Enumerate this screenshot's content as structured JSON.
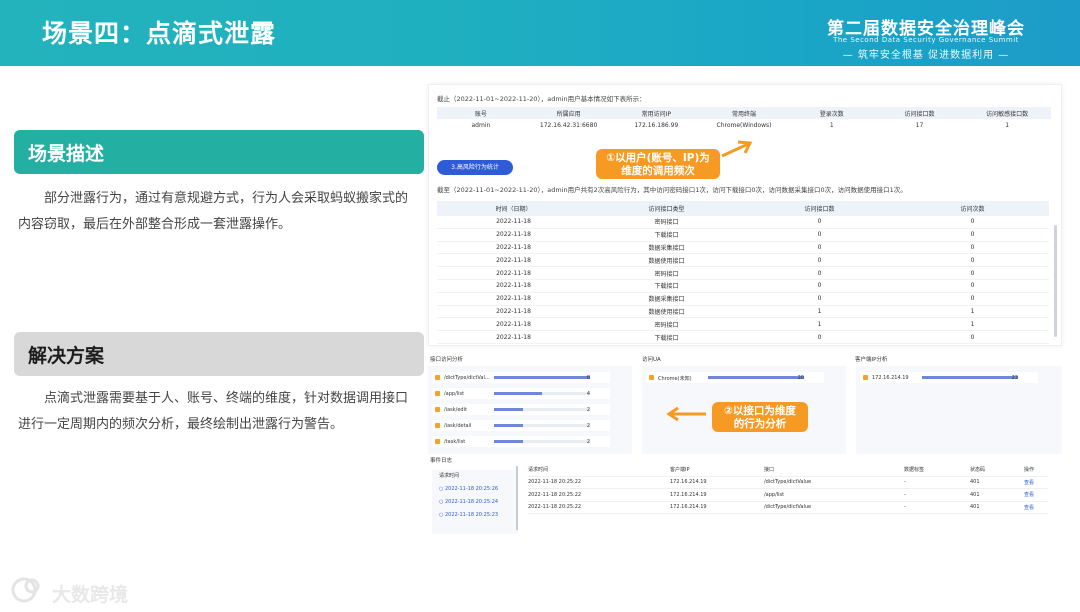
{
  "header": {
    "title": "场景四：点滴式泄露",
    "conf_title": "第二届数据安全治理峰会",
    "conf_en": "The Second Data Security Governance Summit",
    "conf_slogan": "— 筑牢安全根基 促进数据利用 —"
  },
  "scene_desc": {
    "heading": "场景描述",
    "text": "部分泄露行为，通过有意规避方式，行为人会采取蚂蚁搬家式的内容窃取，最后在外部整合形成一套泄露操作。"
  },
  "solution": {
    "heading": "解决方案",
    "text": "点滴式泄露需要基于人、账号、终端的维度，针对数据调用接口进行一定周期内的频次分析，最终绘制出泄露行为警告。"
  },
  "screenshot": {
    "note1": "截止（2022-11-01~2022-11-20），admin用户基本情况如下表所示：",
    "user_table": {
      "headers": [
        "账号",
        "所属应用",
        "常用访问IP",
        "常用终端",
        "登录次数",
        "访问接口数",
        "访问敏感接口数"
      ],
      "row": [
        "admin",
        "172.16.42.31:6680",
        "172.16.186.99",
        "Chrome(Windows)",
        "1",
        "17",
        "1"
      ]
    },
    "pill": "3.高风险行为统计",
    "note2": "截至（2022-11-01~2022-11-20），admin用户共有2次高风险行为，其中访问密码接口1次，访问下载接口0次，访问数据采集接口0次，访问数据使用接口1次。",
    "risk_table": {
      "headers": [
        "时间（日期）",
        "访问接口类型",
        "访问接口数",
        "访问次数"
      ],
      "rows": [
        [
          "2022-11-18",
          "密码接口",
          "0",
          "0"
        ],
        [
          "2022-11-18",
          "下载接口",
          "0",
          "0"
        ],
        [
          "2022-11-18",
          "数据采集接口",
          "0",
          "0"
        ],
        [
          "2022-11-18",
          "数据使用接口",
          "0",
          "0"
        ],
        [
          "2022-11-18",
          "密码接口",
          "0",
          "0"
        ],
        [
          "2022-11-18",
          "下载接口",
          "0",
          "0"
        ],
        [
          "2022-11-18",
          "数据采集接口",
          "0",
          "0"
        ],
        [
          "2022-11-18",
          "数据使用接口",
          "1",
          "1"
        ],
        [
          "2022-11-18",
          "密码接口",
          "1",
          "1"
        ],
        [
          "2022-11-18",
          "下载接口",
          "0",
          "0"
        ]
      ]
    }
  },
  "callouts": {
    "c1": "①以用户(账号、IP)为\n维度的调用频次",
    "c2": "②以接口为维度\n的行为分析"
  },
  "dashboard": {
    "api_panel_label": "接口访问分析",
    "ua_panel_label": "访问UA",
    "ip_panel_label": "客户端IP分析",
    "api_rows": [
      {
        "name": "/dictType/dictVal...",
        "value": "8",
        "fill": 1.0
      },
      {
        "name": "/app/list",
        "value": "4",
        "fill": 0.5
      },
      {
        "name": "/iask/edit",
        "value": "2",
        "fill": 0.3
      },
      {
        "name": "/iask/detail",
        "value": "2",
        "fill": 0.3
      },
      {
        "name": "/task/list",
        "value": "2",
        "fill": 0.3
      }
    ],
    "ua_row": {
      "name": "Chrome(未知)",
      "value": "20",
      "fill": 1.0
    },
    "ip_row": {
      "name": "172.16.214.19",
      "value": "23",
      "fill": 1.0
    }
  },
  "event_log": {
    "label": "事件日志",
    "left_header": "请求时间",
    "times": [
      "2022-11-18 20:25:26",
      "2022-11-18 20:25:24",
      "2022-11-18 20:25:23"
    ],
    "headers": [
      "请求时间",
      "客户端IP",
      "接口",
      "数据标签",
      "状态码",
      "操作"
    ],
    "rows": [
      [
        "2022-11-18 20:25:22",
        "172.16.214.19",
        "/dictType/dictValue",
        "-",
        "401",
        "查看"
      ],
      [
        "2022-11-18 20:25:22",
        "172.16.214.19",
        "/app/list",
        "-",
        "401",
        "查看"
      ],
      [
        "2022-11-18 20:25:22",
        "172.16.214.19",
        "/dictType/dictValue",
        "-",
        "401",
        "查看"
      ]
    ]
  },
  "watermark": "大数跨境"
}
